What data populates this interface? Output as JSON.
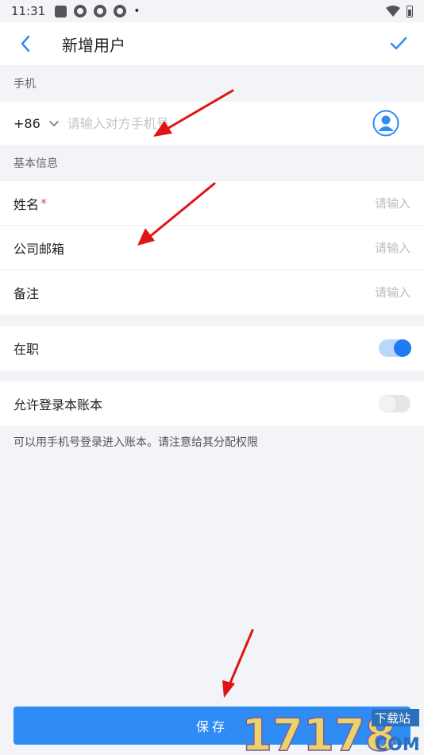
{
  "status_bar": {
    "time": "11:31"
  },
  "app_bar": {
    "title": "新增用户"
  },
  "phone_section": {
    "label": "手机",
    "country_code": "+86",
    "placeholder": "请输入对方手机号"
  },
  "basic_section": {
    "label": "基本信息",
    "fields": [
      {
        "label": "姓名",
        "required_mark": "*",
        "placeholder": "请输入"
      },
      {
        "label": "公司邮箱",
        "placeholder": "请输入"
      },
      {
        "label": "备注",
        "placeholder": "请输入"
      }
    ]
  },
  "employment": {
    "label": "在职",
    "enabled": true
  },
  "allow_login": {
    "label": "允许登录本账本",
    "enabled": false,
    "hint": "可以用手机号登录进入账本。请注意给其分配权限"
  },
  "save_button": {
    "label": "保存"
  },
  "watermark": {
    "text": "17178",
    "sub_text": "下载站",
    "suffix": "COM"
  },
  "colors": {
    "accent": "#2f8cf5",
    "arrow": "#e01414",
    "required": "#e5484d"
  }
}
